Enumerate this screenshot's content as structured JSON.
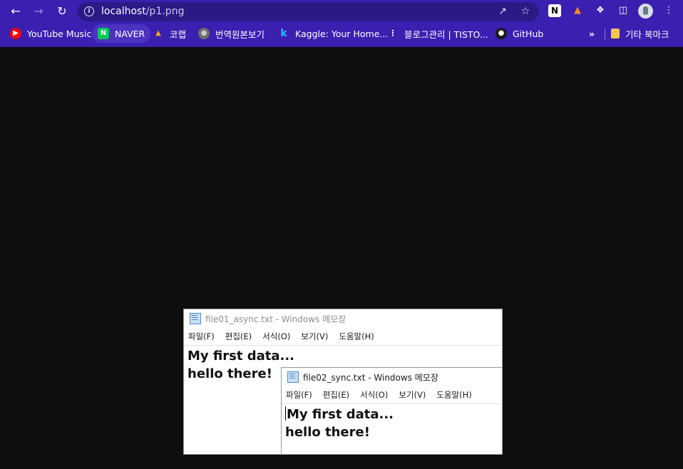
{
  "browser": {
    "url_host": "localhost",
    "url_path": "/p1.png",
    "bookmarks": [
      {
        "label": "YouTube Music",
        "icon": "youtube-music-icon",
        "color": "#ff0000"
      },
      {
        "label": "NAVER",
        "icon": "naver-icon",
        "color": "#03c75a"
      },
      {
        "label": "코랩",
        "icon": "google-drive-icon",
        "color": "#f9ab00"
      },
      {
        "label": "번역원본보기",
        "icon": "globe-icon",
        "color": "#8a8a8a"
      },
      {
        "label": "Kaggle: Your Home...",
        "icon": "kaggle-icon",
        "color": "#20beff"
      },
      {
        "label": "블로그관리 | TISTO...",
        "icon": "tistory-icon",
        "color": "#000000"
      },
      {
        "label": "GitHub",
        "icon": "github-icon",
        "color": "#1a1a1a"
      }
    ],
    "more_label": "»",
    "other_bookmarks": "기타 북마크"
  },
  "notepad1": {
    "title": "file01_async.txt - Windows 메모장",
    "menu": [
      "파일(F)",
      "편집(E)",
      "서식(O)",
      "보기(V)",
      "도움말(H)"
    ],
    "lines": [
      "My first data...",
      "hello there!"
    ]
  },
  "notepad2": {
    "title": "file02_sync.txt - Windows 메모장",
    "menu": [
      "파일(F)",
      "편집(E)",
      "서식(O)",
      "보기(V)",
      "도움말(H)"
    ],
    "lines": [
      "My first data...",
      "hello there!"
    ]
  }
}
